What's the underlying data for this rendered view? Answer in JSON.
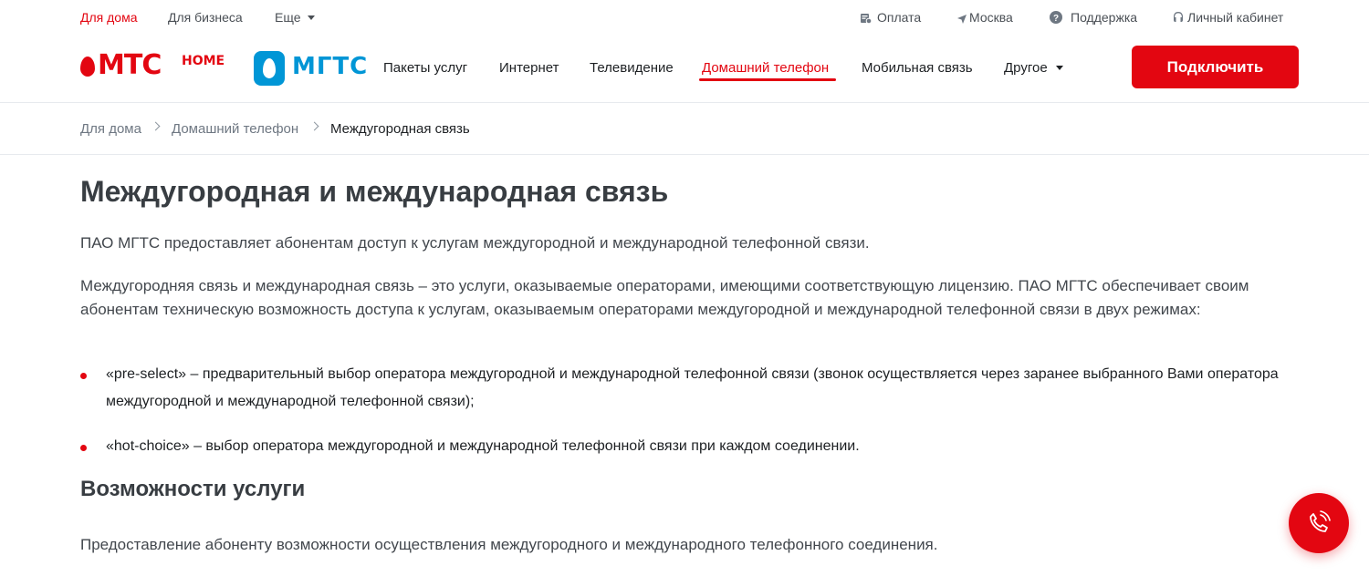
{
  "topbar": {
    "left_links": [
      "Для дома",
      "Для бизнеса",
      "Еще"
    ],
    "right_links": [
      "Оплата",
      "Москва",
      "Поддержка",
      "Личный кабинет"
    ]
  },
  "header": {
    "logo_mts": "МТС",
    "logo_mts_suffix": "HOME",
    "logo_mgts": "МГТС",
    "nav": [
      "Пакеты услуг",
      "Интернет",
      "Телевидение",
      "Домашний телефон",
      "Мобильная связь",
      "Другое"
    ],
    "connect_label": "Подключить"
  },
  "breadcrumb": [
    "Для дома",
    "Домашний телефон",
    "Междугородная связь"
  ],
  "main": {
    "title": "Междугородная и международная связь",
    "intro": "ПАО МГТС предоставляет абонентам доступ к услугам междугородной и международной телефонной связи.",
    "description": "Междугородняя связь и международная связь – это услуги, оказываемые операторами, имеющими соответствующую лицензию. ПАО МГТС обеспечивает своим абонентам техническую возможность доступа к услугам, оказываемым операторами междугородной и международной телефонной связи в двух режимах:",
    "modes": [
      "«pre-select» – предварительный выбор оператора междугородной и международной телефонной связи (звонок осуществляется через заранее выбранного Вами оператора междугородной и международной телефонной связи);",
      "«hot-choice» – выбор оператора междугородной и международной телефонной связи при каждом соединении."
    ],
    "features_heading": "Возможности услуги",
    "features_text": "Предоставление абоненту возможности осуществления междугородного и международного телефонного соединения."
  },
  "colors": {
    "accent": "#e30611",
    "mgts_blue": "#0096d6",
    "text": "#1d2023",
    "muted": "#6e7782"
  },
  "icons": {
    "payment": "wallet-icon",
    "city": "location-arrow-icon",
    "support": "question-circle-icon",
    "account": "user-icon",
    "call": "phone-call-icon"
  }
}
